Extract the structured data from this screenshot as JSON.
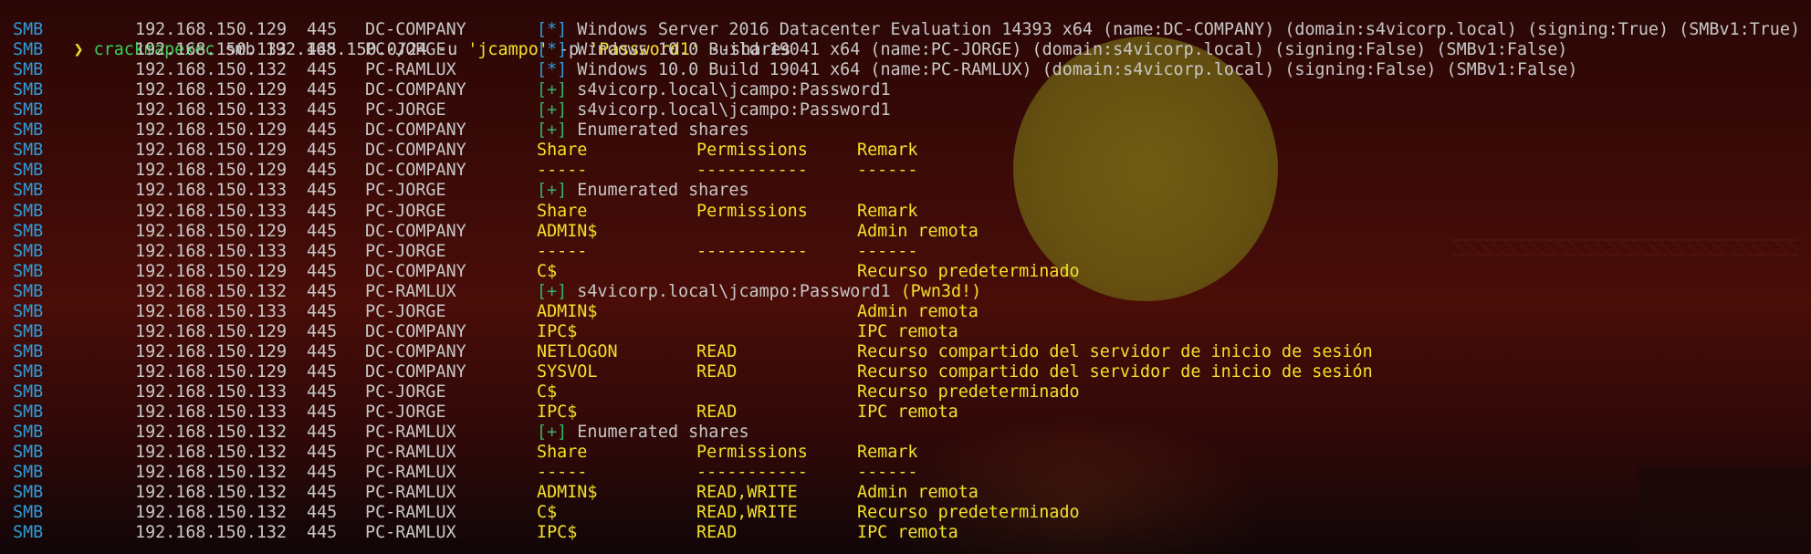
{
  "prompt": {
    "arrow": "❯",
    "program": "crackmapexec",
    "args1": " smb 192.168.150.0/24 -u ",
    "user": "'jcampo'",
    "args2": " -p ",
    "password": "'Password1'",
    "args3": " --shares"
  },
  "info_lines": [
    {
      "proto": "SMB",
      "ip": "192.168.150.129",
      "port": "445",
      "host": "DC-COMPANY",
      "tag": "[*]",
      "msg": " Windows Server 2016 Datacenter Evaluation 14393 x64 (name:DC-COMPANY) (domain:s4vicorp.local) (signing:True) (SMBv1:True)"
    },
    {
      "proto": "SMB",
      "ip": "192.168.150.133",
      "port": "445",
      "host": "PC-JORGE",
      "tag": "[*]",
      "msg": " Windows 10.0 Build 19041 x64 (name:PC-JORGE) (domain:s4vicorp.local) (signing:False) (SMBv1:False)"
    },
    {
      "proto": "SMB",
      "ip": "192.168.150.132",
      "port": "445",
      "host": "PC-RAMLUX",
      "tag": "[*]",
      "msg": " Windows 10.0 Build 19041 x64 (name:PC-RAMLUX) (domain:s4vicorp.local) (signing:False) (SMBv1:False)"
    },
    {
      "proto": "SMB",
      "ip": "192.168.150.129",
      "port": "445",
      "host": "DC-COMPANY",
      "tag": "[+]",
      "msg": " s4vicorp.local\\jcampo:Password1"
    },
    {
      "proto": "SMB",
      "ip": "192.168.150.133",
      "port": "445",
      "host": "PC-JORGE",
      "tag": "[+]",
      "msg": " s4vicorp.local\\jcampo:Password1"
    },
    {
      "proto": "SMB",
      "ip": "192.168.150.129",
      "port": "445",
      "host": "DC-COMPANY",
      "tag": "[+]",
      "msg": " Enumerated shares"
    }
  ],
  "share_lines": [
    {
      "proto": "SMB",
      "ip": "192.168.150.129",
      "port": "445",
      "host": "DC-COMPANY",
      "share": "Share",
      "perm": "Permissions",
      "remark": "Remark"
    },
    {
      "proto": "SMB",
      "ip": "192.168.150.129",
      "port": "445",
      "host": "DC-COMPANY",
      "share": "-----",
      "perm": "-----------",
      "remark": "------"
    },
    {
      "proto": "SMB",
      "ip": "192.168.150.133",
      "port": "445",
      "host": "PC-JORGE",
      "tag": "[+]",
      "msg": " Enumerated shares"
    },
    {
      "proto": "SMB",
      "ip": "192.168.150.133",
      "port": "445",
      "host": "PC-JORGE",
      "share": "Share",
      "perm": "Permissions",
      "remark": "Remark"
    },
    {
      "proto": "SMB",
      "ip": "192.168.150.129",
      "port": "445",
      "host": "DC-COMPANY",
      "share": "ADMIN$",
      "perm": "",
      "remark": "Admin remota"
    },
    {
      "proto": "SMB",
      "ip": "192.168.150.133",
      "port": "445",
      "host": "PC-JORGE",
      "share": "-----",
      "perm": "-----------",
      "remark": "------"
    },
    {
      "proto": "SMB",
      "ip": "192.168.150.129",
      "port": "445",
      "host": "DC-COMPANY",
      "share": "C$",
      "perm": "",
      "remark": "Recurso predeterminado"
    },
    {
      "proto": "SMB",
      "ip": "192.168.150.132",
      "port": "445",
      "host": "PC-RAMLUX",
      "tag": "[+]",
      "msg": " s4vicorp.local\\jcampo:Password1",
      "pwn": " (Pwn3d!)"
    },
    {
      "proto": "SMB",
      "ip": "192.168.150.133",
      "port": "445",
      "host": "PC-JORGE",
      "share": "ADMIN$",
      "perm": "",
      "remark": "Admin remota"
    },
    {
      "proto": "SMB",
      "ip": "192.168.150.129",
      "port": "445",
      "host": "DC-COMPANY",
      "share": "IPC$",
      "perm": "",
      "remark": "IPC remota"
    },
    {
      "proto": "SMB",
      "ip": "192.168.150.129",
      "port": "445",
      "host": "DC-COMPANY",
      "share": "NETLOGON",
      "perm": "READ",
      "remark": "Recurso compartido del servidor de inicio de sesión"
    },
    {
      "proto": "SMB",
      "ip": "192.168.150.129",
      "port": "445",
      "host": "DC-COMPANY",
      "share": "SYSVOL",
      "perm": "READ",
      "remark": "Recurso compartido del servidor de inicio de sesión"
    },
    {
      "proto": "SMB",
      "ip": "192.168.150.133",
      "port": "445",
      "host": "PC-JORGE",
      "share": "C$",
      "perm": "",
      "remark": "Recurso predeterminado"
    },
    {
      "proto": "SMB",
      "ip": "192.168.150.133",
      "port": "445",
      "host": "PC-JORGE",
      "share": "IPC$",
      "perm": "READ",
      "remark": "IPC remota"
    },
    {
      "proto": "SMB",
      "ip": "192.168.150.132",
      "port": "445",
      "host": "PC-RAMLUX",
      "tag": "[+]",
      "msg": " Enumerated shares"
    },
    {
      "proto": "SMB",
      "ip": "192.168.150.132",
      "port": "445",
      "host": "PC-RAMLUX",
      "share": "Share",
      "perm": "Permissions",
      "remark": "Remark"
    },
    {
      "proto": "SMB",
      "ip": "192.168.150.132",
      "port": "445",
      "host": "PC-RAMLUX",
      "share": "-----",
      "perm": "-----------",
      "remark": "------"
    },
    {
      "proto": "SMB",
      "ip": "192.168.150.132",
      "port": "445",
      "host": "PC-RAMLUX",
      "share": "ADMIN$",
      "perm": "READ,WRITE",
      "remark": "Admin remota"
    },
    {
      "proto": "SMB",
      "ip": "192.168.150.132",
      "port": "445",
      "host": "PC-RAMLUX",
      "share": "C$",
      "perm": "READ,WRITE",
      "remark": "Recurso predeterminado"
    },
    {
      "proto": "SMB",
      "ip": "192.168.150.132",
      "port": "445",
      "host": "PC-RAMLUX",
      "share": "IPC$",
      "perm": "READ",
      "remark": "IPC remota"
    }
  ],
  "colors": {
    "proto": "#2f9bd7",
    "tag_info": "#2f9bd7",
    "tag_success": "#35b36a",
    "share_text": "#f2e12a",
    "program": "#3ccf5a"
  }
}
